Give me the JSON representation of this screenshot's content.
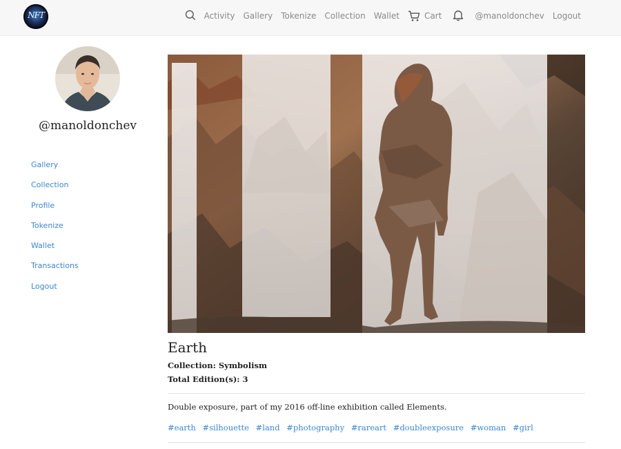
{
  "app": {
    "logo_text": "NFT"
  },
  "header": {
    "nav": [
      "Activity",
      "Gallery",
      "Tokenize",
      "Collection",
      "Wallet"
    ],
    "cart_label": "Cart",
    "username": "@manoldonchev",
    "logout": "Logout",
    "icons": [
      "search-icon",
      "cart-icon",
      "bell-icon"
    ]
  },
  "sidebar": {
    "username": "@manoldonchev",
    "menu": [
      "Gallery",
      "Collection",
      "Profile",
      "Tokenize",
      "Wallet",
      "Transactions",
      "Logout"
    ]
  },
  "artwork": {
    "title": "Earth",
    "collection": "Collection: Symbolism",
    "editions": "Total Edition(s): 3",
    "description": "Double exposure, part of my 2016 off-line exhibition called Elements.",
    "tags": [
      "#earth",
      "#silhouette",
      "#land",
      "#photography",
      "#rareart",
      "#doubleexposure",
      "#woman",
      "#girl"
    ]
  },
  "colors": {
    "link": "#3c86d2",
    "header_bg": "#f7f7f8",
    "nav_text": "#8a8a8a"
  }
}
